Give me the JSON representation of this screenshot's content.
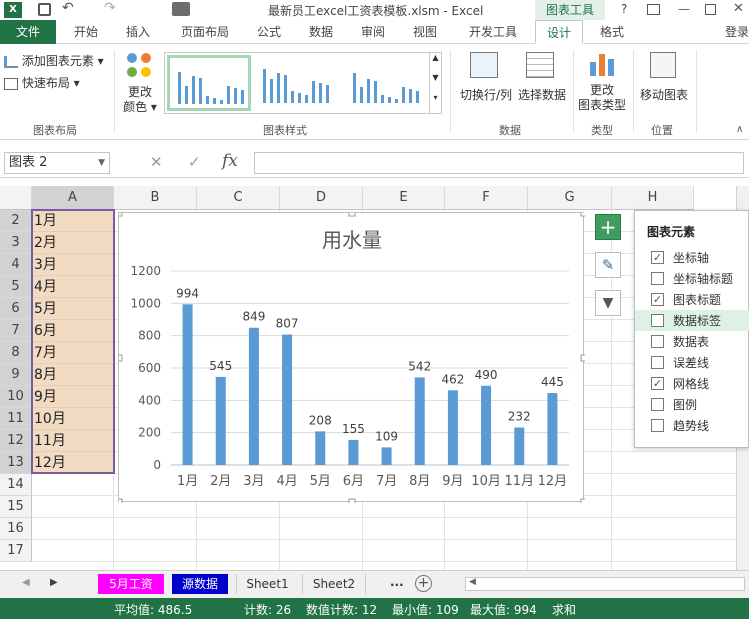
{
  "title": {
    "text": "最新员工excel工资表模板.xlsm - Excel",
    "context_tab": "图表工具",
    "help": "?",
    "login": "登录"
  },
  "tabs": [
    "文件",
    "开始",
    "插入",
    "页面布局",
    "公式",
    "数据",
    "审阅",
    "视图",
    "开发工具",
    "设计",
    "格式"
  ],
  "ribbon": {
    "add_element": "添加图表元素 ▾",
    "quick_layout": "快速布局 ▾",
    "change_colors": "更改\n颜色 ▾",
    "group_layout": "图表布局",
    "group_styles": "图表样式",
    "switch_row_col": "切换行/列",
    "select_data": "选择数据",
    "group_data": "数据",
    "change_type": "更改\n图表类型",
    "group_type": "类型",
    "move_chart": "移动图表",
    "group_location": "位置"
  },
  "formula_bar": {
    "name_box": "图表 2",
    "fx": "fx",
    "cancel": "✕",
    "confirm": "✓"
  },
  "columns": [
    "A",
    "B",
    "C",
    "D",
    "E",
    "F",
    "G",
    "H"
  ],
  "rows": [
    "2",
    "3",
    "4",
    "5",
    "6",
    "7",
    "8",
    "9",
    "10",
    "11",
    "12",
    "13",
    "14",
    "15",
    "16",
    "17"
  ],
  "cells_a": [
    "1月",
    "2月",
    "3月",
    "4月",
    "5月",
    "6月",
    "7月",
    "8月",
    "9月",
    "10月",
    "11月",
    "12月"
  ],
  "chart_data": {
    "type": "bar",
    "title": "用水量",
    "categories": [
      "1月",
      "2月",
      "3月",
      "4月",
      "5月",
      "6月",
      "7月",
      "8月",
      "9月",
      "10月",
      "11月",
      "12月"
    ],
    "values": [
      994,
      545,
      849,
      807,
      208,
      155,
      109,
      542,
      462,
      490,
      232,
      445
    ],
    "ylim": [
      0,
      1200
    ],
    "yticks": [
      "0",
      "200",
      "400",
      "600",
      "800",
      "1000",
      "1200"
    ],
    "grid": true,
    "bar_color": "#5b9bd5"
  },
  "chart_elements": {
    "heading": "图表元素",
    "items": [
      {
        "label": "坐标轴",
        "checked": true
      },
      {
        "label": "坐标轴标题",
        "checked": false
      },
      {
        "label": "图表标题",
        "checked": true
      },
      {
        "label": "数据标签",
        "checked": false
      },
      {
        "label": "数据表",
        "checked": false
      },
      {
        "label": "误差线",
        "checked": false
      },
      {
        "label": "网格线",
        "checked": true
      },
      {
        "label": "图例",
        "checked": false
      },
      {
        "label": "趋势线",
        "checked": false
      }
    ]
  },
  "sheets": [
    "5月工资",
    "源数据",
    "Sheet1",
    "Sheet2",
    "..."
  ],
  "status": {
    "avg": "平均值: 486.5",
    "count": "计数: 26",
    "num_count": "数值计数: 12",
    "min": "最小值: 109",
    "max": "最大值: 994",
    "sum": "求和"
  },
  "colors": {
    "excel_green": "#217346",
    "design_tab": "#217346",
    "sheet1_tab": "#ff00ff",
    "sheet2_tab": "#0000cc",
    "cell_fill": "#f1dcc3"
  }
}
